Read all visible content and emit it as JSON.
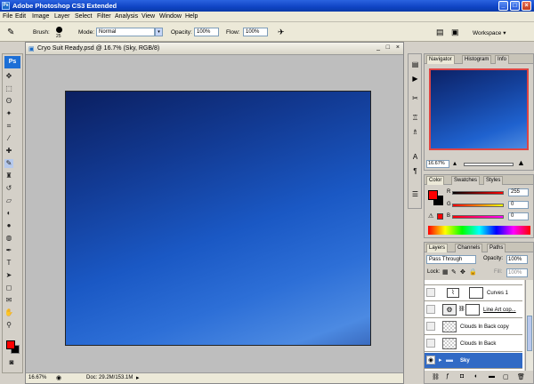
{
  "app": {
    "title": "Adobe Photoshop CS3 Extended",
    "logo": "Ps",
    "window_buttons": [
      "_",
      "□",
      "×"
    ]
  },
  "menu": [
    "File",
    "Edit",
    "Image",
    "Layer",
    "Select",
    "Filter",
    "Analysis",
    "View",
    "Window",
    "Help"
  ],
  "options": {
    "brush_label": "Brush:",
    "brush_size": "25",
    "mode_label": "Mode:",
    "mode_value": "Normal",
    "opacity_label": "Opacity:",
    "opacity_value": "100%",
    "flow_label": "Flow:",
    "flow_value": "100%",
    "workspace_label": "Workspace ▾"
  },
  "document": {
    "tab_title": "Cryo Suit Ready.psd @ 16.7% (Sky, RGB/8)",
    "zoom": "16.67%",
    "doc_info": "Doc: 29.2M/153.1M"
  },
  "navigator": {
    "tabs": [
      "Navigator",
      "Histogram",
      "Info"
    ],
    "zoom": "16.67%"
  },
  "color_panel": {
    "tabs": [
      "Color",
      "Swatches",
      "Styles"
    ],
    "r_label": "R",
    "r_value": "255",
    "g_label": "G",
    "g_value": "0",
    "b_label": "B",
    "b_value": "0",
    "foreground": "#ff0000",
    "background": "#000000"
  },
  "layers_panel": {
    "tabs": [
      "Layers",
      "Channels",
      "Paths"
    ],
    "blend_mode": "Pass Through",
    "opacity_label": "Opacity:",
    "opacity_value": "100%",
    "lock_label": "Lock:",
    "fill_label": "Fill:",
    "fill_value": "100%",
    "layers": [
      {
        "name": "Curves 1"
      },
      {
        "name": "Line Art cop..."
      },
      {
        "name": "Clouds In Back copy"
      },
      {
        "name": "Clouds In Back"
      },
      {
        "name": "Sky"
      }
    ]
  }
}
